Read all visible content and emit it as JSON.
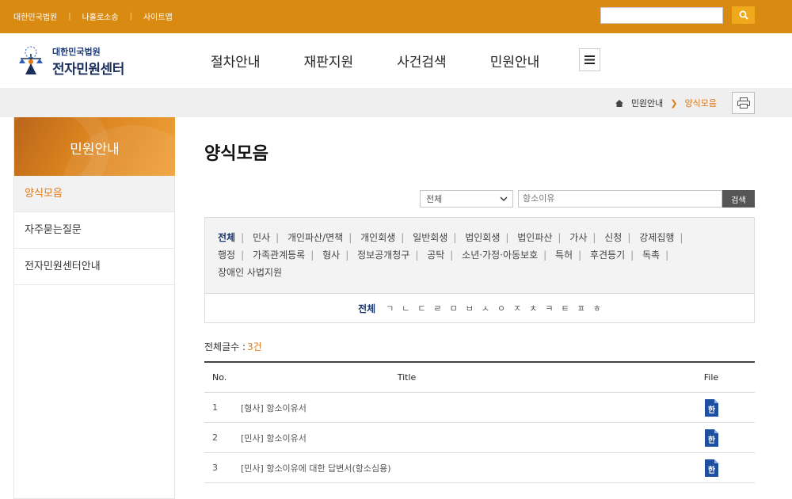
{
  "top_links": [
    "대한민국법원",
    "나홀로소송",
    "사이트맵"
  ],
  "site": {
    "sub_title": "대한민국법원",
    "main_title": "전자민원센터"
  },
  "gnb": [
    "절차안내",
    "재판지원",
    "사건검색",
    "민원안내"
  ],
  "breadcrumb": {
    "parent": "민원안내",
    "current": "양식모음"
  },
  "sidebar": {
    "title": "민원안내",
    "items": [
      "양식모음",
      "자주묻는질문",
      "전자민원센터안내"
    ],
    "active_index": 0
  },
  "page_title": "양식모음",
  "filter": {
    "select_value": "전체",
    "search_value": "항소이유",
    "search_button": "검색"
  },
  "categories": {
    "line1": [
      "전체",
      "민사",
      "개인파산/면책",
      "개인회생",
      "일반회생",
      "법인회생",
      "법인파산",
      "가사",
      "신청",
      "강제집행"
    ],
    "line2": [
      "행정",
      "가족관계등록",
      "형사",
      "정보공개청구",
      "공탁",
      "소년·가정·아동보호",
      "특허",
      "후견등기",
      "독촉"
    ],
    "line3": [
      "장애인 사법지원"
    ]
  },
  "consonants": [
    "전체",
    "ㄱ",
    "ㄴ",
    "ㄷ",
    "ㄹ",
    "ㅁ",
    "ㅂ",
    "ㅅ",
    "ㅇ",
    "ㅈ",
    "ㅊ",
    "ㅋ",
    "ㅌ",
    "ㅍ",
    "ㅎ"
  ],
  "count": {
    "label": "전체글수 :",
    "value": "3건"
  },
  "table": {
    "headers": {
      "no": "No.",
      "title": "Title",
      "file": "File"
    },
    "rows": [
      {
        "no": "1",
        "title": "[형사] 항소이유서",
        "file_icon": "hwp-file-icon"
      },
      {
        "no": "2",
        "title": "[민사] 항소이유서",
        "file_icon": "hwp-file-icon"
      },
      {
        "no": "3",
        "title": "[민사] 항소이유에 대한 답변서(항소심용)",
        "file_icon": "hwp-file-icon"
      }
    ]
  },
  "colors": {
    "top_bar": "#d98a10",
    "accent": "#e07818",
    "nav_blue": "#1a3a6e"
  }
}
